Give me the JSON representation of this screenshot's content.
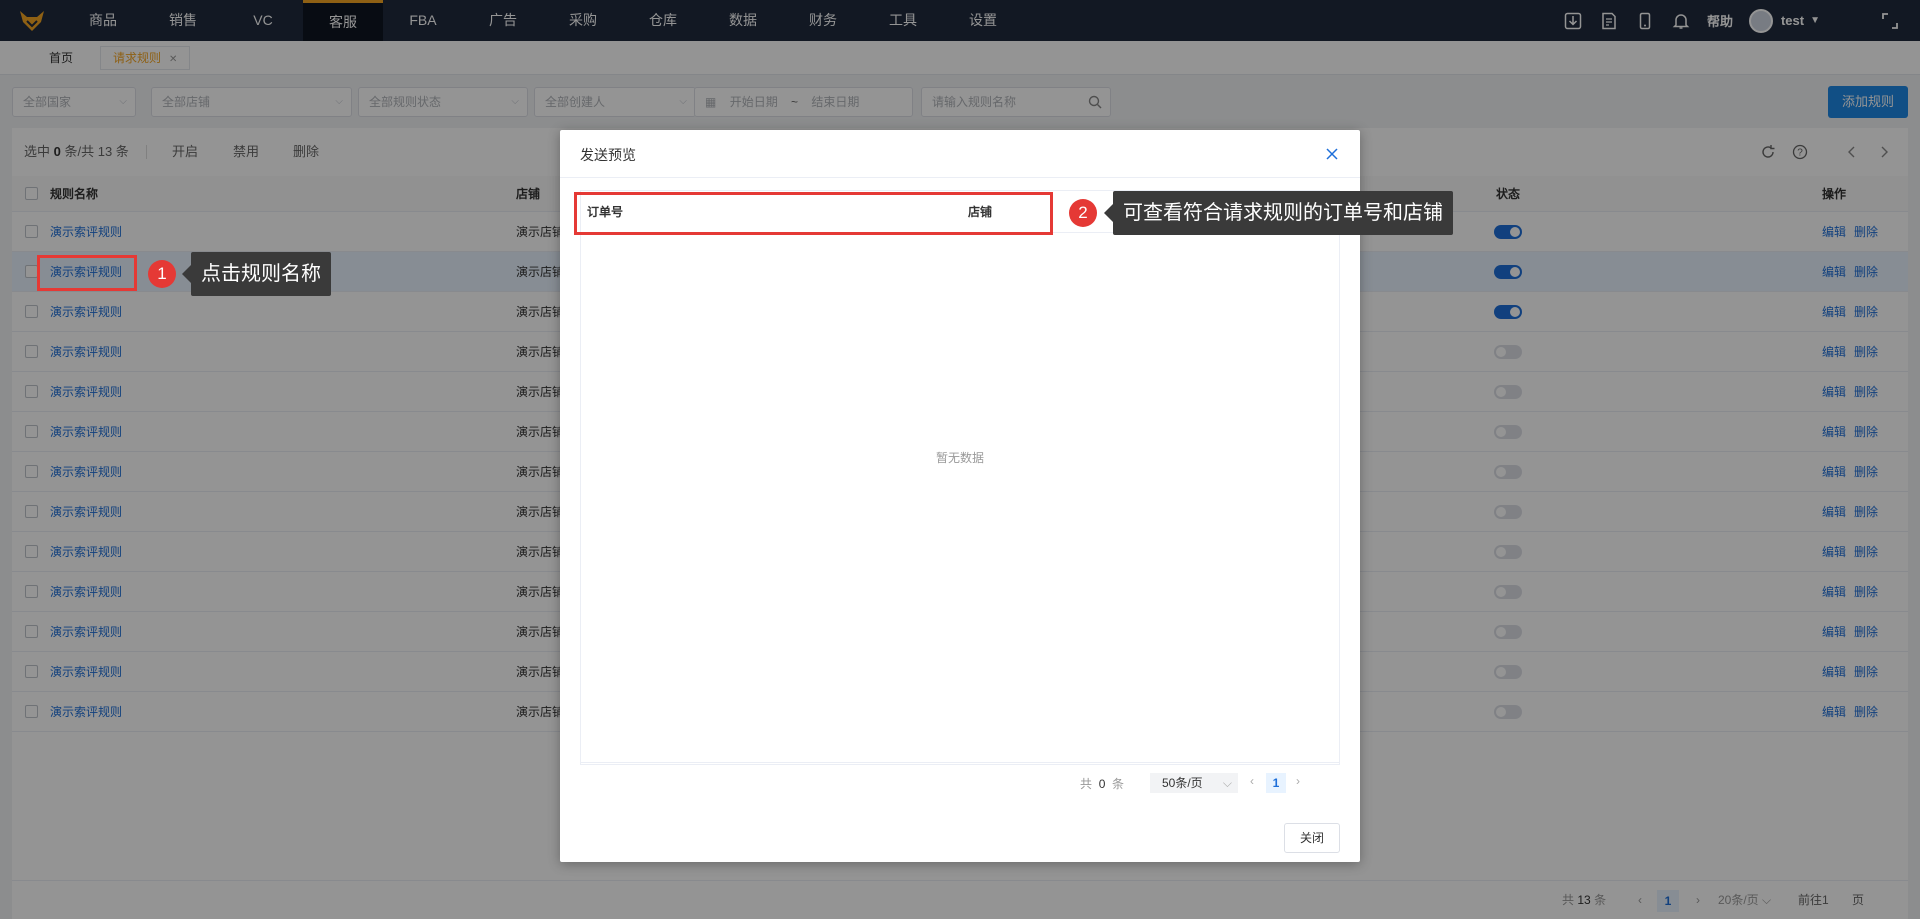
{
  "nav": {
    "items": [
      "商品",
      "销售",
      "VC",
      "客服",
      "FBA",
      "广告",
      "采购",
      "仓库",
      "数据",
      "财务",
      "工具",
      "设置"
    ],
    "help": "帮助",
    "user": "test"
  },
  "tabs": {
    "home": "首页",
    "current": "请求规则"
  },
  "filters": {
    "country": "全部国家",
    "shop": "全部店铺",
    "status": "全部规则状态",
    "creator": "全部创建人",
    "start_date": "开始日期",
    "sep": "~",
    "end_date": "结束日期",
    "search_placeholder": "请输入规则名称",
    "add": "添加规则"
  },
  "toolbar": {
    "selected_prefix": "选中",
    "selected_count": "0",
    "selected_suffix": "条/共 13 条",
    "enable": "开启",
    "disable": "禁用",
    "delete": "删除"
  },
  "table": {
    "headers": {
      "name": "规则名称",
      "shop": "店铺",
      "status": "状态",
      "ops": "操作"
    },
    "rows": [
      {
        "name": "演示索评规则",
        "shop": "演示店铺",
        "on": true
      },
      {
        "name": "演示索评规则",
        "shop": "演示店铺",
        "on": true
      },
      {
        "name": "演示索评规则",
        "shop": "演示店铺",
        "on": true
      },
      {
        "name": "演示索评规则",
        "shop": "演示店铺",
        "on": false
      },
      {
        "name": "演示索评规则",
        "shop": "演示店铺",
        "on": false
      },
      {
        "name": "演示索评规则",
        "shop": "演示店铺",
        "on": false
      },
      {
        "name": "演示索评规则",
        "shop": "演示店铺",
        "on": false
      },
      {
        "name": "演示索评规则",
        "shop": "演示店铺",
        "on": false
      },
      {
        "name": "演示索评规则",
        "shop": "演示店铺",
        "on": false
      },
      {
        "name": "演示索评规则",
        "shop": "演示店铺",
        "on": false
      },
      {
        "name": "演示索评规则",
        "shop": "演示店铺",
        "on": false
      },
      {
        "name": "演示索评规则",
        "shop": "演示店铺",
        "on": false
      },
      {
        "name": "演示索评规则",
        "shop": "演示店铺",
        "on": false
      }
    ],
    "edit": "编辑",
    "delete": "删除"
  },
  "pager": {
    "total_prefix": "共",
    "total": "13",
    "total_suffix": "条",
    "page": "1",
    "page_size": "20条/页",
    "goto": "前往",
    "goto_value": "1",
    "goto_suffix": "页"
  },
  "dialog": {
    "title": "发送预览",
    "col_order": "订单号",
    "col_shop": "店铺",
    "empty": "暂无数据",
    "total_prefix": "共",
    "total": "0",
    "total_suffix": "条",
    "page_size": "50条/页",
    "page": "1",
    "close": "关闭"
  },
  "annotations": {
    "step1_num": "1",
    "step1_text": "点击规则名称",
    "step2_num": "2",
    "step2_text": "可查看符合请求规则的订单号和店铺"
  },
  "colors": {
    "nav_bg": "#1f2a3d",
    "accent_orange": "#f5a623",
    "primary": "#1e6fd9",
    "annotation_red": "#e53935"
  }
}
